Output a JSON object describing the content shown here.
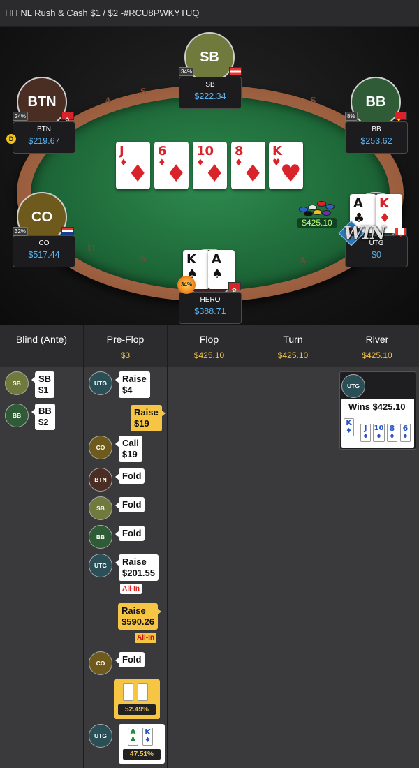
{
  "title": "HH NL Rush & Cash $1 / $2 -#RCU8PWKYTUQ",
  "rail_letters": [
    "A",
    "S",
    "S",
    "U",
    "S",
    "A"
  ],
  "seats": [
    {
      "id": "sb",
      "label": "SB",
      "name": "SB",
      "stack": "$222.34",
      "pct": "34%",
      "avatar_color": "#6f7a3c",
      "flag": "austria"
    },
    {
      "id": "btn",
      "label": "BTN",
      "name": "BTN",
      "stack": "$219.67",
      "pct": "24%",
      "avatar_color": "#4a2e24",
      "flag": "hongkong"
    },
    {
      "id": "bb",
      "label": "BB",
      "name": "BB",
      "stack": "$253.62",
      "pct": "8%",
      "avatar_color": "#2f5b37",
      "flag": "china"
    },
    {
      "id": "co",
      "label": "CO",
      "name": "CO",
      "stack": "$517.44",
      "pct": "32%",
      "avatar_color": "#6d5a1c",
      "flag": "croatia"
    },
    {
      "id": "utg",
      "label": "",
      "name": "UTG",
      "stack": "$0",
      "pct": "20%",
      "avatar_color": "#2b4f57",
      "flag": "canada"
    },
    {
      "id": "hero",
      "label": "",
      "name": "HERO",
      "stack": "$388.71",
      "pct": "34%",
      "avatar_color": "#5b2a2a",
      "flag": "hongkong"
    }
  ],
  "dealer_button": "D",
  "board": [
    {
      "rank": "J",
      "suit": "♦",
      "color": "red"
    },
    {
      "rank": "6",
      "suit": "♦",
      "color": "red"
    },
    {
      "rank": "10",
      "suit": "♦",
      "color": "red"
    },
    {
      "rank": "8",
      "suit": "♦",
      "color": "red"
    },
    {
      "rank": "K",
      "suit": "♥",
      "color": "red"
    }
  ],
  "utg_cards": [
    {
      "rank": "A",
      "suit": "♣"
    },
    {
      "rank": "K",
      "suit": "♦"
    }
  ],
  "hero_cards": [
    {
      "rank": "K",
      "suit": "♠"
    },
    {
      "rank": "A",
      "suit": "♠"
    }
  ],
  "pot": "$425.10",
  "win_text": "WIN",
  "hero_equity_badge": "34%",
  "history": {
    "columns": [
      {
        "title": "Blind (Ante)",
        "pot": ""
      },
      {
        "title": "Pre-Flop",
        "pot": "$3"
      },
      {
        "title": "Flop",
        "pot": "$425.10"
      },
      {
        "title": "Turn",
        "pot": "$425.10"
      },
      {
        "title": "River",
        "pot": "$425.10"
      }
    ],
    "blinds": [
      {
        "pos": "SB",
        "text1": "SB",
        "text2": "$1"
      },
      {
        "pos": "BB",
        "text1": "BB",
        "text2": "$2"
      }
    ],
    "preflop": [
      {
        "pos": "UTG",
        "l1": "Raise",
        "l2": "$4",
        "hero": false
      },
      {
        "pos": "",
        "l1": "Raise",
        "l2": "$19",
        "hero": true
      },
      {
        "pos": "CO",
        "l1": "Call",
        "l2": "$19",
        "hero": false
      },
      {
        "pos": "BTN",
        "l1": "Fold",
        "l2": "",
        "hero": false
      },
      {
        "pos": "SB",
        "l1": "Fold",
        "l2": "",
        "hero": false
      },
      {
        "pos": "BB",
        "l1": "Fold",
        "l2": "",
        "hero": false
      },
      {
        "pos": "UTG",
        "l1": "Raise",
        "l2": "$201.55",
        "hero": false,
        "allin": "All-In"
      },
      {
        "pos": "",
        "l1": "Raise",
        "l2": "$590.26",
        "hero": true,
        "allin": "All-In"
      },
      {
        "pos": "CO",
        "l1": "Fold",
        "l2": "",
        "hero": false
      }
    ],
    "hero_showdown": {
      "cards": [
        {
          "rank": "K",
          "suit": "♠"
        },
        {
          "rank": "A",
          "suit": "♠"
        }
      ],
      "equity": "52.49%"
    },
    "utg_showdown": {
      "pos": "UTG",
      "cards": [
        {
          "rank": "A",
          "suit": "♣"
        },
        {
          "rank": "K",
          "suit": "♦"
        }
      ],
      "equity": "47.51%"
    },
    "river_win": {
      "pos": "UTG",
      "text": "Wins $425.10",
      "cards": [
        {
          "rank": "K",
          "suit": "♦"
        },
        {
          "rank": "J",
          "suit": "♦"
        },
        {
          "rank": "10",
          "suit": "♦"
        },
        {
          "rank": "8",
          "suit": "♦"
        },
        {
          "rank": "6",
          "suit": "♦"
        }
      ]
    }
  },
  "colors": {
    "stack_blue": "#5ab4f0",
    "pot_gold": "#f1c24a",
    "felt": "#1f6b3a"
  }
}
